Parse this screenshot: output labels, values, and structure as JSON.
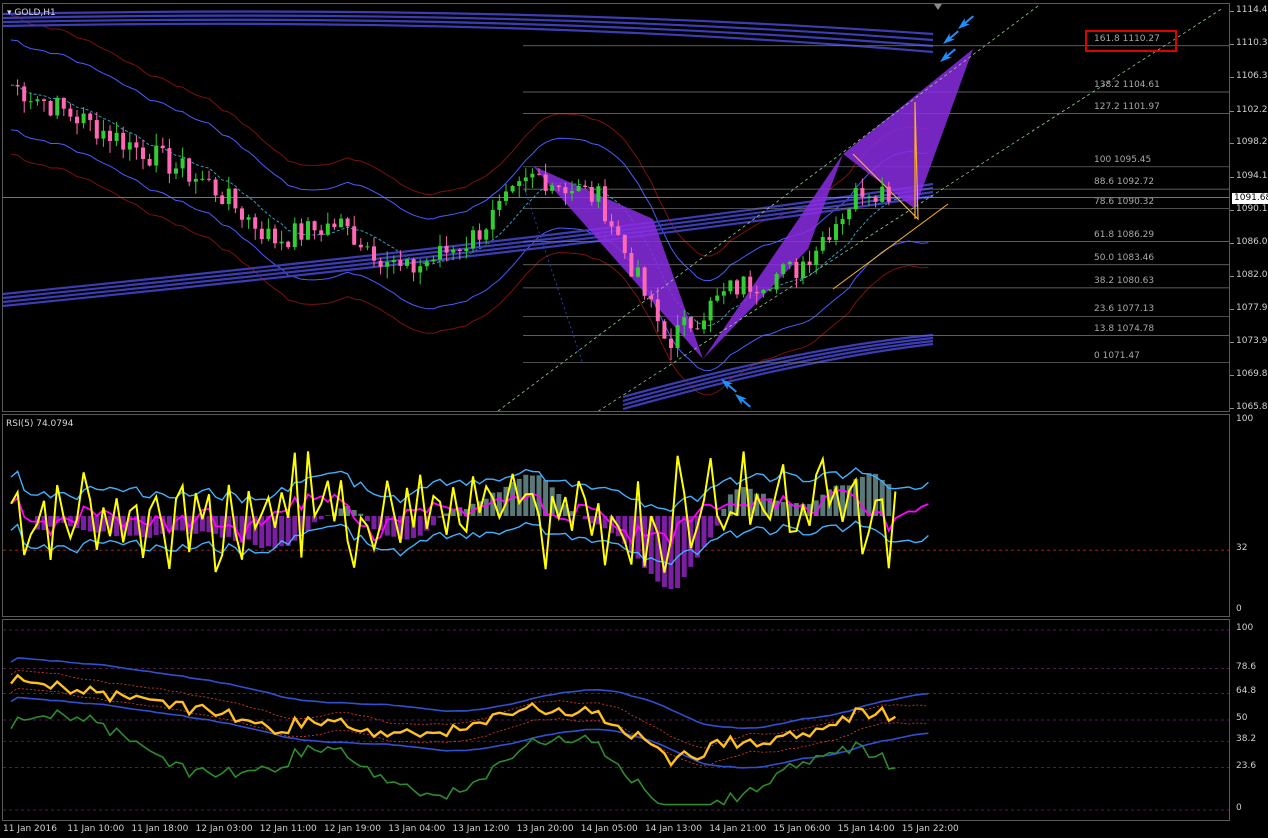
{
  "main": {
    "title": "GOLD,H1",
    "current_price_tag": "1091.68",
    "price_axis": [
      "1114.40",
      "1110.30",
      "1106.30",
      "1102.20",
      "1098.20",
      "1094.10",
      "1090.10",
      "1086.00",
      "1082.00",
      "1077.90",
      "1073.90",
      "1069.80",
      "1065.80"
    ],
    "fib_levels": [
      {
        "label": "161.8 1110.27",
        "price": 1110.27
      },
      {
        "label": "138.2 1104.61",
        "price": 1104.61
      },
      {
        "label": "127.2 1101.97",
        "price": 1101.97
      },
      {
        "label": "100 1095.45",
        "price": 1095.45
      },
      {
        "label": "88.6 1092.72",
        "price": 1092.72
      },
      {
        "label": "78.6 1090.32",
        "price": 1090.32
      },
      {
        "label": "61.8 1086.29",
        "price": 1086.29
      },
      {
        "label": "50.0 1083.46",
        "price": 1083.46
      },
      {
        "label": "38.2 1080.63",
        "price": 1080.63
      },
      {
        "label": "23.6 1077.13",
        "price": 1077.13
      },
      {
        "label": "13.8 1074.78",
        "price": 1074.78
      },
      {
        "label": "0 1071.47",
        "price": 1071.47
      }
    ],
    "colors": {
      "bull": "#32cd32",
      "bear": "#ff69b4",
      "pattern": "#8a2be2",
      "band": "#3c3cb4",
      "fib": "#7a7a7a",
      "arrow": "#1e90ff",
      "highlight": "#e00000"
    }
  },
  "rsi": {
    "title": "RSI(5) 74.0794",
    "axis": [
      "100",
      "32",
      "0"
    ],
    "colors": {
      "rsi": "#ffff00",
      "band": "#40b0ff",
      "mid": "#ff00ff",
      "hist_pos": "#5a7878",
      "hist_neg": "#7b1fa2"
    }
  },
  "osc": {
    "axis": [
      "100",
      "78.6",
      "64.8",
      "50",
      "38.2",
      "23.6",
      "0"
    ],
    "colors": {
      "main": "#ffc020",
      "green": "#2e8b2e",
      "blue": "#3050d0",
      "red_dash": "#e04030"
    }
  },
  "time_axis": [
    "11 Jan 2016",
    "11 Jan 10:00",
    "11 Jan 18:00",
    "12 Jan 03:00",
    "12 Jan 11:00",
    "12 Jan 19:00",
    "13 Jan 04:00",
    "13 Jan 12:00",
    "13 Jan 20:00",
    "14 Jan 05:00",
    "14 Jan 13:00",
    "14 Jan 21:00",
    "15 Jan 06:00",
    "15 Jan 14:00",
    "15 Jan 22:00"
  ],
  "chart_data": {
    "type": "line",
    "title": "GOLD,H1",
    "ylim": [
      1065.8,
      1114.4
    ],
    "x": [
      "11 Jan 2016",
      "11 Jan 10:00",
      "11 Jan 18:00",
      "12 Jan 03:00",
      "12 Jan 11:00",
      "12 Jan 19:00",
      "13 Jan 04:00",
      "13 Jan 12:00",
      "13 Jan 20:00",
      "14 Jan 05:00",
      "14 Jan 13:00",
      "14 Jan 21:00",
      "15 Jan 06:00",
      "15 Jan 14:00",
      "15 Jan 22:00"
    ],
    "series": [
      {
        "values": [
          1105.5,
          1101.5,
          1097.5,
          1093.5,
          1086.5,
          1088.5,
          1082.5,
          1086.5,
          1094.5,
          1091.5,
          1074.0,
          1080.5,
          1083.0,
          1093.0,
          1091.7
        ]
      }
    ]
  }
}
